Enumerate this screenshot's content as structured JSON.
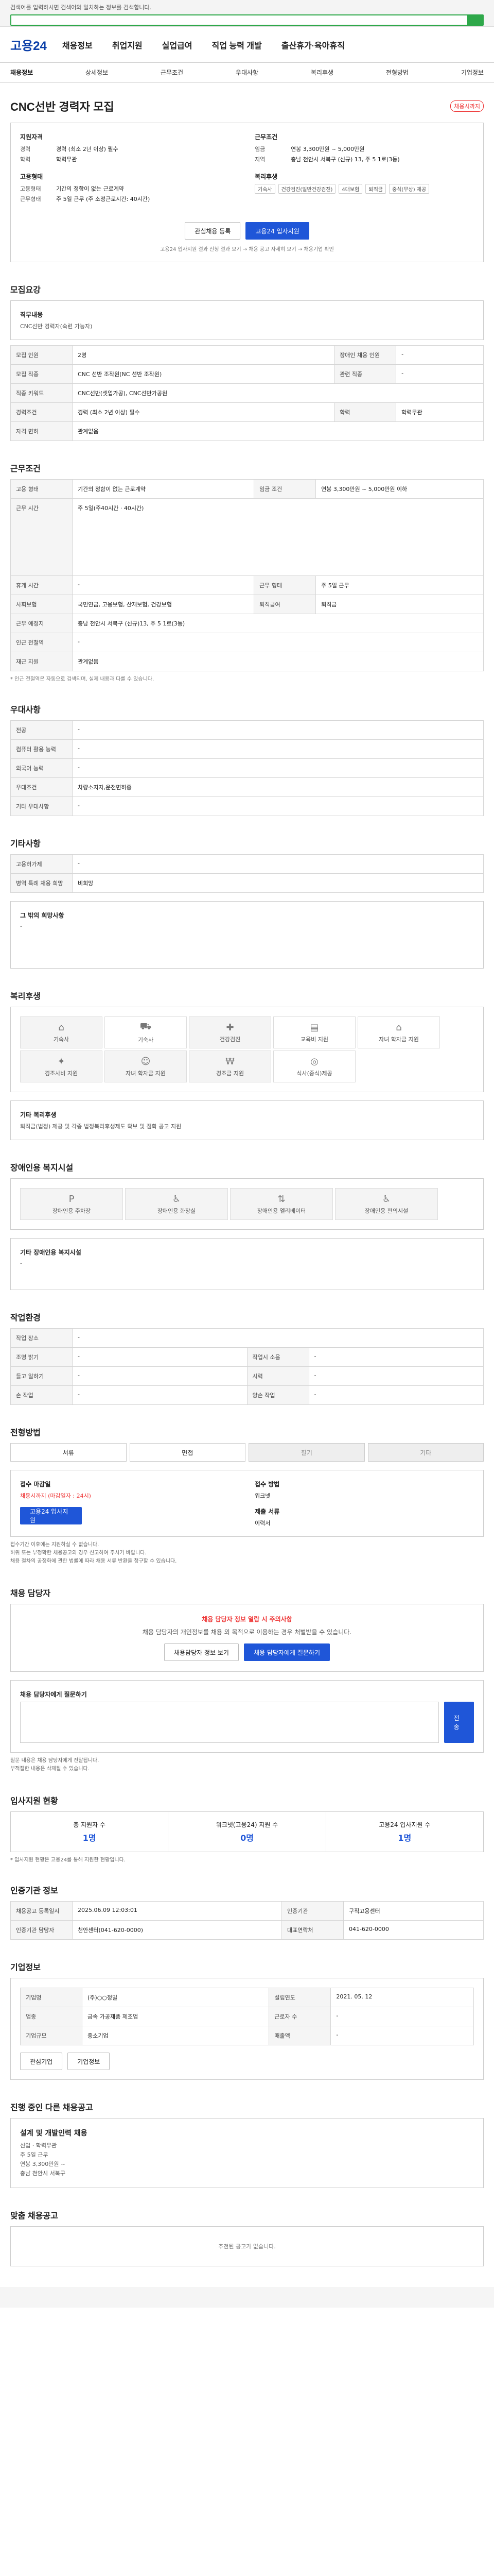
{
  "topbar": {
    "hint": "검색어를 입력하시면 검색어와 일치하는 정보를 검색합니다."
  },
  "header": {
    "logo": "고용24",
    "nav": [
      "채용정보",
      "취업지원",
      "실업급여",
      "직업 능력 개발",
      "출산휴가·육아휴직"
    ]
  },
  "subnav": [
    "채용정보",
    "상세정보",
    "근무조건",
    "우대사항",
    "복리후생",
    "전형방법",
    "기업정보"
  ],
  "posting": {
    "title": "CNC선반 경력자 모집",
    "badge": "채용시까지"
  },
  "summary": {
    "left_title": "지원자격",
    "left": [
      {
        "k": "경력",
        "v": "경력 (최소 2년 이상) 필수"
      },
      {
        "k": "학력",
        "v": "학력무관"
      }
    ],
    "left2_title": "고용형태",
    "left2": [
      {
        "k": "고용형태",
        "v": "기간의 정함이 없는 근로계약"
      },
      {
        "k": "근무형태",
        "v": "주 5일 근무 (주 소정근로시간: 40시간)"
      }
    ],
    "right_title": "근무조건",
    "right": [
      {
        "k": "임금",
        "v": "연봉 3,300만원 ~ 5,000만원"
      },
      {
        "k": "지역",
        "v": "충남 천안시 서북구 (신규) 13, 주 5 1로(3동)"
      }
    ],
    "welfare_title": "복리후생",
    "welfare_tags": [
      "기숙사",
      "건강검진(일반건강검진)",
      "4대보험",
      "퇴직금",
      "중식(무상) 제공"
    ],
    "buttons": [
      "관심채용 등록",
      "고용24 입사지원"
    ],
    "note": "고용24 입사지원 결과 신청 결과 보기 → 채용 공고 자세히 보기 → 채용기업 확인"
  },
  "recruit": {
    "title": "모집요강",
    "job_label": "직무내용",
    "job_value": "CNC선반 경력자(숙련 가능자)",
    "rows": [
      [
        "모집 인원",
        "2명",
        "장애인 채용 인원",
        "-"
      ],
      [
        "모집 직종",
        "CNC 선반 조작원(NC 선반 조작원)",
        "관련 직종",
        "-"
      ],
      [
        "직종 키워드",
        "CNC선반(셋업가공), CNC선반가공원",
        "",
        ""
      ],
      [
        "경력조건",
        "경력 (최소 2년 이상) 필수",
        "학력",
        "학력무관"
      ],
      [
        "자격 면허",
        "관계없음",
        "",
        ""
      ]
    ]
  },
  "conditions": {
    "title": "근무조건",
    "rows": [
      [
        "고용 형태",
        "기간의 정함이 없는 근로계약",
        "임금 조건",
        "연봉 3,300만원 ~ 5,000만원 이하"
      ],
      [
        "근무 시간",
        "주 5일(주40시간 · 40시간)",
        "",
        ""
      ],
      [
        "휴게 시간",
        "-",
        "근무 형태",
        "주 5일 근무"
      ],
      [
        "사회보험",
        "국민연금, 고용보험, 산재보험, 건강보험",
        "퇴직급여",
        "퇴직금"
      ],
      [
        "근무 예정지",
        "충남 천안시 서북구 (신규)13, 주 5 1로(3동)",
        "",
        ""
      ],
      [
        "인근 전철역",
        "-",
        "",
        ""
      ],
      [
        "재근 지원",
        "관계없음",
        "",
        ""
      ]
    ],
    "note": "* 인근 전철역은 자동으로 검색되며, 실제 내용과 다를 수 있습니다."
  },
  "preferred": {
    "title": "우대사항",
    "rows": [
      [
        "전공",
        "-"
      ],
      [
        "컴퓨터 활용 능력",
        "-"
      ],
      [
        "외국어 능력",
        "-"
      ],
      [
        "우대조건",
        "차량소지자,운전면허증"
      ],
      [
        "기타 우대사항",
        "-"
      ]
    ]
  },
  "other": {
    "title": "기타사항",
    "rows": [
      [
        "고용허가제",
        "-"
      ],
      [
        "병역 특례 채용 희망",
        "비희망"
      ]
    ],
    "extra_label": "그 밖의 희망사항",
    "extra_value": "-"
  },
  "welfare": {
    "title": "복리후생",
    "cells": [
      "기숙사",
      "기숙사",
      "건강검진",
      "교육비 지원",
      "자녀 학자금 지원",
      "경조사비 지원",
      "자녀 학자금 지원",
      "경조금 지원",
      "식사(중식)제공"
    ],
    "other_label": "기타 복리후생",
    "other_value": "퇴직금(법정) 제공 및 각종 법정복리후생제도 확보 및 점화 공고 지원"
  },
  "disabled_welfare": {
    "title": "장애인용 복지시설",
    "cells": [
      "장애인용 주차장",
      "장애인용 화장실",
      "장애인용 엘리베이터",
      "장애인용 편의시설"
    ],
    "other_label": "기타 장애인용 복지시설",
    "other_value": "-"
  },
  "env": {
    "title": "작업환경",
    "rows": [
      [
        "작업 장소",
        "-",
        "",
        ""
      ],
      [
        "조명 밝기",
        "-",
        "작업시 소음",
        "-"
      ],
      [
        "들고 일하기",
        "-",
        "시력",
        "-"
      ],
      [
        "손 작업",
        "-",
        "양손 작업",
        "-"
      ]
    ]
  },
  "process": {
    "title": "전형방법",
    "steps": [
      "서류",
      "면접",
      "필기",
      "기타"
    ],
    "period_label": "접수 마감일",
    "period_value": "채용시까지 (마감일자 : 24시)",
    "method_label": "접수 방법",
    "method_value": "워크넷",
    "apply_btn": "고용24 입사지원",
    "docs_label": "제출 서류",
    "docs_value": "이력서",
    "notes": [
      "접수기간 이후에는 지원하실 수 없습니다.",
      "허위 또는 부정확한 채용공고의 경우 신고하여 주시기 바랍니다.",
      "채용 절차의 공정화에 관한 법률에 따라 채용 서류 반환을 청구할 수 있습니다."
    ]
  },
  "contact": {
    "title": "채용 담당자",
    "warn": "채용 담당자 정보 열람 시 주의사항",
    "desc": "채용 담당자의 개인정보를 채용 외 목적으로 이용하는 경우 처벌받을 수 있습니다.",
    "buttons": [
      "채용담당자 정보 보기",
      "채용 담당자에게 질문하기"
    ],
    "question_label": "채용 담당자에게 질문하기",
    "send_btn": "전송",
    "notes": [
      "질문 내용은 채용 담당자에게 전달됩니다.",
      "부적절한 내용은 삭제될 수 있습니다."
    ]
  },
  "status": {
    "title": "입사지원 현황",
    "labels": [
      "총 지원자 수",
      "워크넷(고용24) 지원 수",
      "고용24 입사지원 수"
    ],
    "values": [
      "1명",
      "0명",
      "1명"
    ],
    "note": "* 입사지원 현황은 고용24를 통해 지원한 현황입니다."
  },
  "info": {
    "title": "인증기관 정보",
    "rows": [
      [
        "채용공고 등록일시",
        "2025.06.09 12:03:01",
        "인증기관",
        "구직고용센터"
      ],
      [
        "인증기관 담당자",
        "천안센터(041-620-0000)",
        "대표연락처",
        "041-620-0000"
      ]
    ]
  },
  "company": {
    "title": "기업정보",
    "rows": [
      [
        "기업명",
        "(주)○○정밀",
        "설립연도",
        "2021. 05. 12"
      ],
      [
        "업종",
        "금속 가공제품 제조업",
        "근로자 수",
        "-"
      ],
      [
        "기업규모",
        "중소기업",
        "매출액",
        "-"
      ]
    ],
    "buttons": [
      "관심기업",
      "기업정보"
    ]
  },
  "similar": {
    "title": "진행 중인 다른 채용공고",
    "card_title": "설계 및 개발인력 채용",
    "card_lines": [
      "신입 · 학력무관",
      "주 5일 근무",
      "연봉 3,300만원 ~",
      "충남 천안시 서북구"
    ]
  },
  "recommend": {
    "title": "맞춤 채용공고",
    "empty": "추천된 공고가 없습니다."
  }
}
